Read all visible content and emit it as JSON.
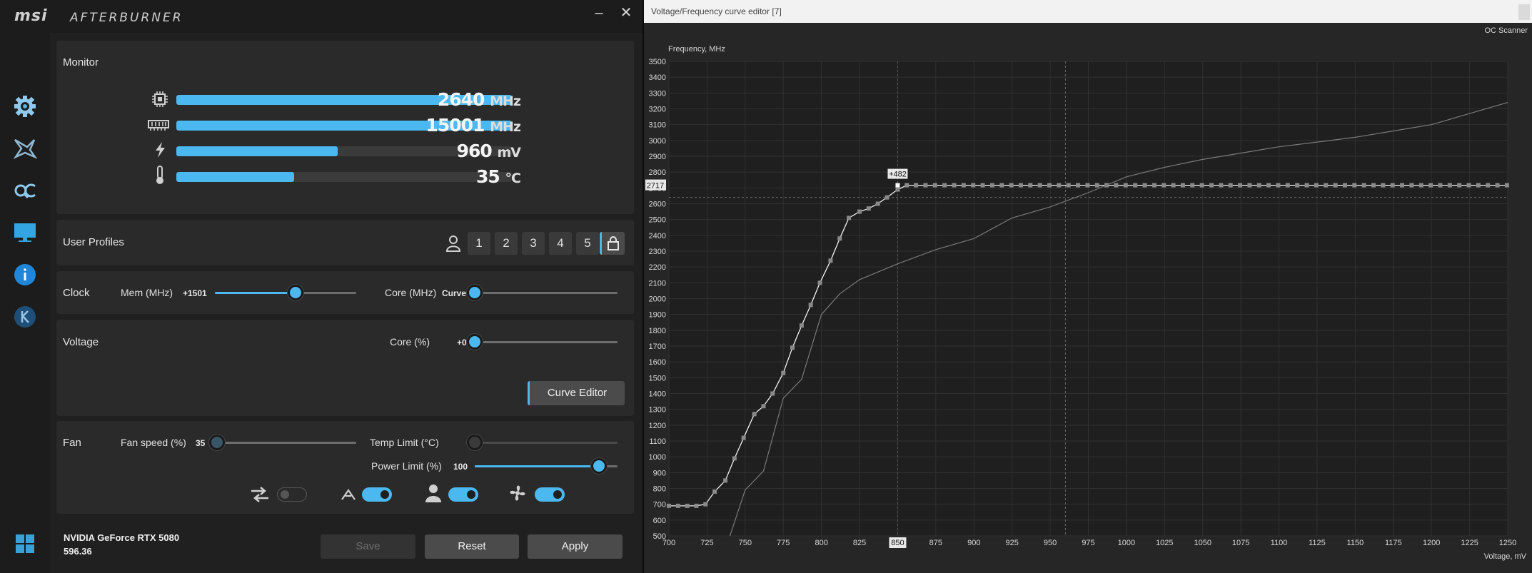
{
  "afterburner": {
    "logo_brand": "msi",
    "logo_product": "AFTERBURNER",
    "window_buttons": {
      "minimize": "–",
      "close": "✕"
    },
    "monitor": {
      "title": "Monitor",
      "rows": [
        {
          "icon": "gpu-chip-icon",
          "value": "2640",
          "unit": "MHz",
          "fill": 1.0
        },
        {
          "icon": "memory-icon",
          "value": "15001",
          "unit": "MHz",
          "fill": 1.0
        },
        {
          "icon": "voltage-icon",
          "value": "960",
          "unit": "mV",
          "fill": 0.48
        },
        {
          "icon": "temperature-icon",
          "value": "35",
          "unit": "°C",
          "fill": 0.35
        }
      ]
    },
    "profiles": {
      "title": "User Profiles",
      "slots": [
        "1",
        "2",
        "3",
        "4",
        "5"
      ],
      "locked": true
    },
    "clock": {
      "title": "Clock",
      "mem_label": "Mem (MHz)",
      "mem_value": "+1501",
      "mem_fraction": 0.57,
      "core_label": "Core (MHz)",
      "core_value": "Curve",
      "core_fraction": 0.0
    },
    "voltage": {
      "title": "Voltage",
      "core_label": "Core (%)",
      "core_value": "+0",
      "core_fraction": 0.0,
      "curve_editor_button": "Curve Editor"
    },
    "fan": {
      "title": "Fan",
      "speed_label": "Fan speed (%)",
      "speed_value": "35",
      "speed_fraction": 0.0,
      "temp_limit_label": "Temp Limit (°C)",
      "temp_limit_fraction": 0.0,
      "power_limit_label": "Power Limit (%)",
      "power_limit_value": "100",
      "power_limit_fraction": 0.87,
      "toggles": [
        {
          "icon": "sync-arrows-icon",
          "on": false
        },
        {
          "icon": "auto-mode-icon",
          "on": true
        },
        {
          "icon": "user-icon",
          "on": true
        },
        {
          "icon": "fan-icon",
          "on": true
        }
      ]
    },
    "footer": {
      "gpu_name": "NVIDIA GeForce RTX 5080",
      "driver": "596.36",
      "save": "Save",
      "reset": "Reset",
      "apply": "Apply"
    },
    "colors": {
      "accent": "#4bb8ef",
      "panel": "#2a2a2a",
      "background": "#202020"
    }
  },
  "curve_editor": {
    "title": "Voltage/Frequency curve editor [7]",
    "oc_scanner": "OC Scanner",
    "chart_data": {
      "type": "line",
      "xlabel": "Voltage, mV",
      "ylabel": "Frequency, MHz",
      "xlim": [
        700,
        1250
      ],
      "ylim": [
        500,
        3500
      ],
      "x_ticks": [
        700,
        725,
        750,
        775,
        800,
        825,
        850,
        875,
        900,
        925,
        950,
        975,
        1000,
        1025,
        1050,
        1075,
        1100,
        1125,
        1150,
        1175,
        1200,
        1225,
        1250
      ],
      "y_ticks": [
        500,
        600,
        700,
        800,
        900,
        1000,
        1100,
        1200,
        1300,
        1400,
        1500,
        1600,
        1700,
        1800,
        1900,
        2000,
        2100,
        2200,
        2300,
        2400,
        2500,
        2600,
        2700,
        2800,
        2900,
        3000,
        3100,
        3200,
        3300,
        3400,
        3500
      ],
      "selected_voltage": "850",
      "selected_frequency": "2717",
      "selected_offset": "+482",
      "guide_frequency": 2640,
      "guide_voltage": 960,
      "series": [
        {
          "style": "edited",
          "points": [
            [
              700,
              690
            ],
            [
              706,
              690
            ],
            [
              712,
              690
            ],
            [
              718,
              690
            ],
            [
              724,
              700
            ],
            [
              730,
              780
            ],
            [
              737,
              850
            ],
            [
              743,
              990
            ],
            [
              749,
              1120
            ],
            [
              756,
              1270
            ],
            [
              762,
              1320
            ],
            [
              768,
              1400
            ],
            [
              775,
              1530
            ],
            [
              781,
              1690
            ],
            [
              787,
              1830
            ],
            [
              793,
              1960
            ],
            [
              799,
              2100
            ],
            [
              806,
              2240
            ],
            [
              812,
              2380
            ],
            [
              818,
              2510
            ],
            [
              825,
              2550
            ],
            [
              831,
              2570
            ],
            [
              837,
              2600
            ],
            [
              843,
              2640
            ],
            [
              850,
              2690
            ],
            [
              856,
              2717
            ],
            [
              1250,
              2717
            ]
          ]
        },
        {
          "style": "base",
          "points": [
            [
              740,
              500
            ],
            [
              750,
              790
            ],
            [
              762,
              910
            ],
            [
              775,
              1370
            ],
            [
              787,
              1490
            ],
            [
              800,
              1900
            ],
            [
              812,
              2030
            ],
            [
              825,
              2120
            ],
            [
              850,
              2220
            ],
            [
              875,
              2310
            ],
            [
              900,
              2380
            ],
            [
              925,
              2510
            ],
            [
              950,
              2580
            ],
            [
              975,
              2670
            ],
            [
              1000,
              2770
            ],
            [
              1025,
              2830
            ],
            [
              1050,
              2880
            ],
            [
              1075,
              2920
            ],
            [
              1100,
              2960
            ],
            [
              1125,
              2990
            ],
            [
              1150,
              3020
            ],
            [
              1175,
              3060
            ],
            [
              1200,
              3100
            ],
            [
              1225,
              3170
            ],
            [
              1250,
              3240
            ]
          ]
        }
      ]
    }
  }
}
